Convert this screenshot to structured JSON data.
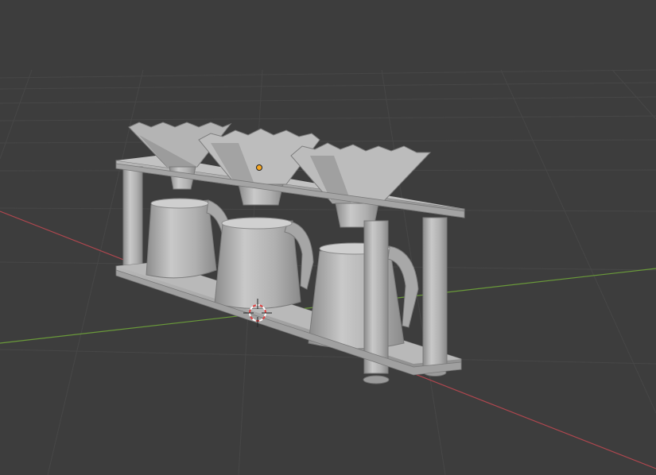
{
  "viewport": {
    "background": "#3d3d3d",
    "grid_color": "#464646",
    "x_axis_color": "#b0474f",
    "y_axis_color": "#6a9a3a"
  },
  "scene": {
    "objects": [
      "coffee-dripper-stand",
      "dripper-left",
      "dripper-middle",
      "dripper-right",
      "kettle-left",
      "kettle-middle",
      "kettle-right"
    ],
    "material_color": "#b3b3b3",
    "origin_dot_color": "#f5a623"
  },
  "cursor": {
    "icon": "3d-cursor-icon",
    "colors": [
      "#e04040",
      "#ffffff"
    ]
  }
}
